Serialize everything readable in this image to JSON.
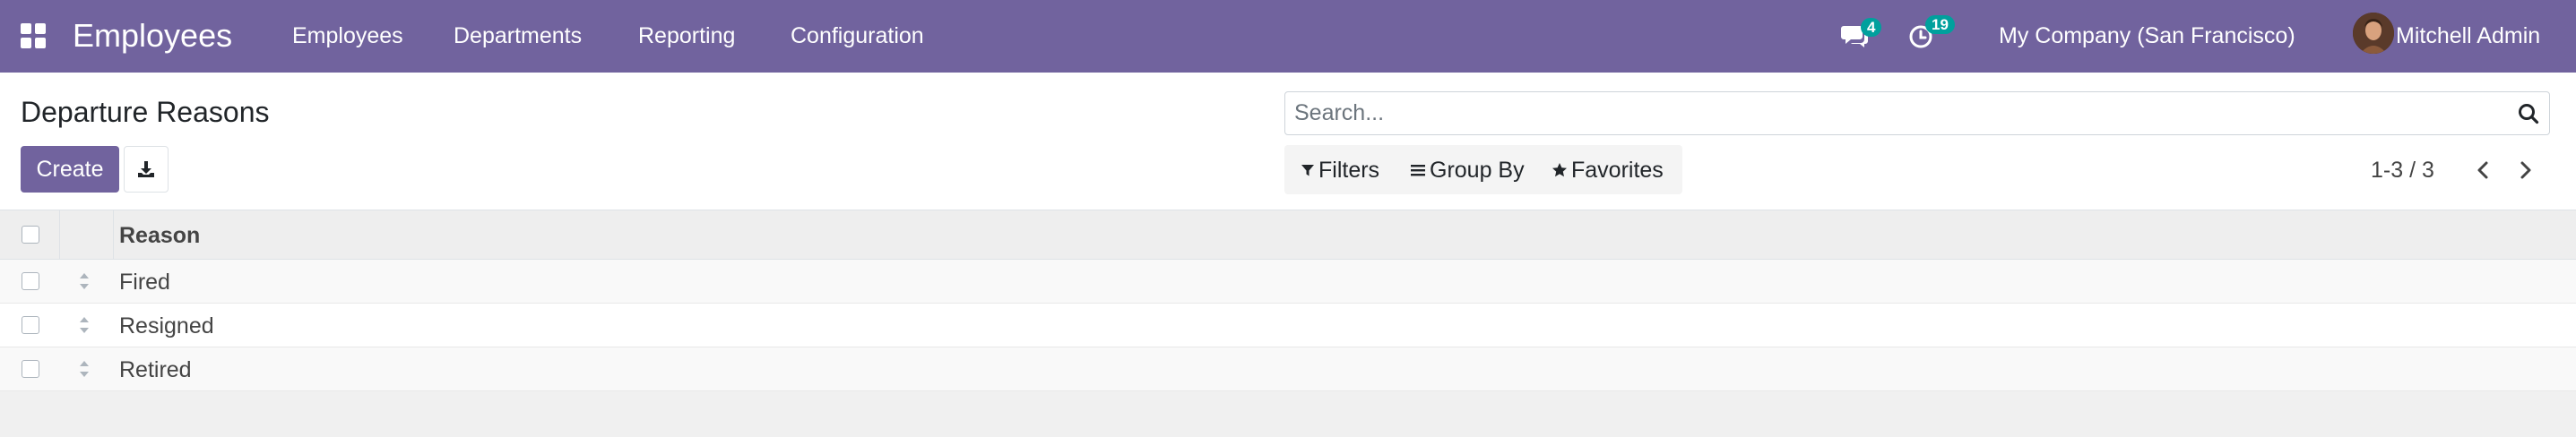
{
  "navbar": {
    "app_title": "Employees",
    "menu": [
      {
        "label": "Employees"
      },
      {
        "label": "Departments"
      },
      {
        "label": "Reporting"
      },
      {
        "label": "Configuration"
      }
    ],
    "messages_count": "4",
    "activities_count": "19",
    "company": "My Company (San Francisco)",
    "user": "Mitchell Admin",
    "colors": {
      "bar": "#71639e",
      "badge": "#00a09d"
    }
  },
  "control_panel": {
    "title": "Departure Reasons",
    "create_label": "Create",
    "search_placeholder": "Search...",
    "filters_label": "Filters",
    "group_by_label": "Group By",
    "favorites_label": "Favorites",
    "pager": "1-3 / 3"
  },
  "list": {
    "columns": [
      "Reason"
    ],
    "rows": [
      {
        "reason": "Fired"
      },
      {
        "reason": "Resigned"
      },
      {
        "reason": "Retired"
      }
    ]
  }
}
